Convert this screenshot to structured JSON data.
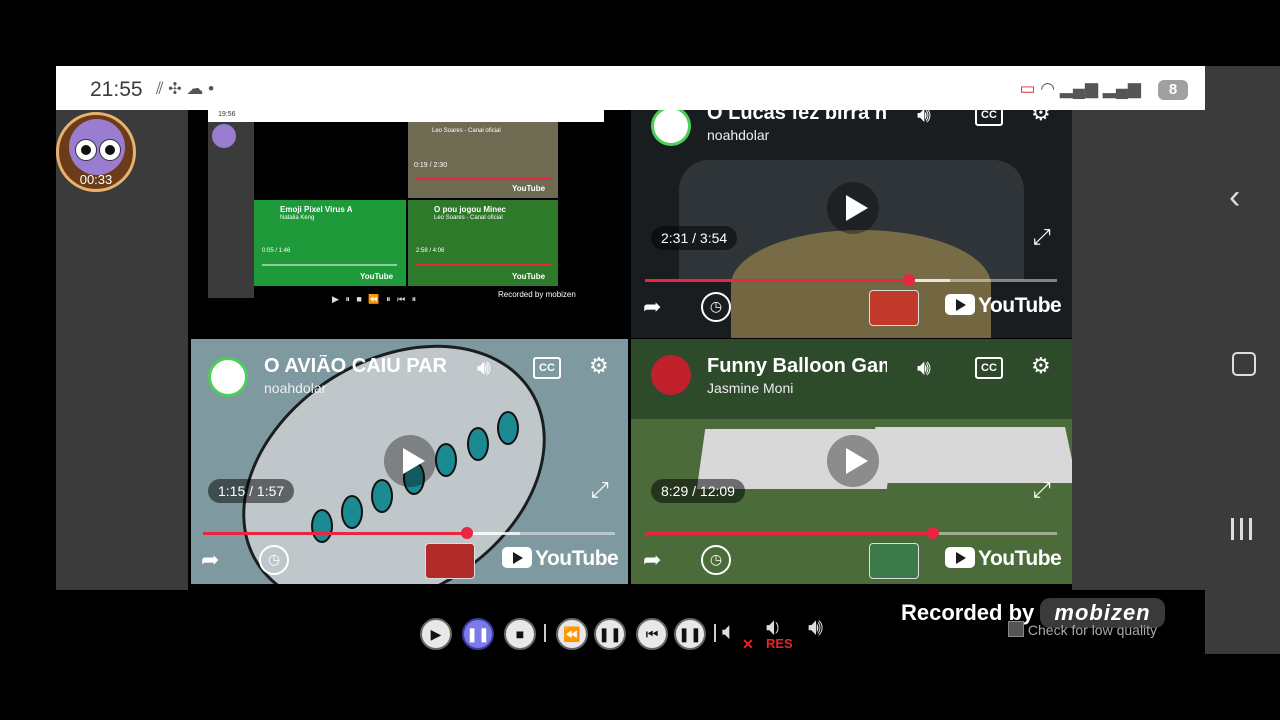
{
  "status": {
    "time": "21:55",
    "icons_left": "⫽ ✣ ☁ •",
    "battery": "8"
  },
  "avatar": {
    "time": "00:33"
  },
  "mini": {
    "time": "19:56",
    "v1_title": "Emoji Pixel Virus A",
    "v1_channel": "Natalia Keng",
    "v1_time": "0:05 / 1:46",
    "v2_title": "O pou jogou Minec",
    "v2_channel": "Leo Soares - Canal oficial",
    "v2_time": "2:58 / 4:06",
    "v3_channel": "Leo Soares - Canal oficial",
    "v3_time": "0:19 / 2:30",
    "yt_label": "YouTube",
    "recorded_label": "Recorded by mobizen"
  },
  "videos": [
    {
      "title": "O Lucas fez birra n",
      "channel": "noahdolar",
      "current": "2:31",
      "total": "3:54",
      "progress": 0.64,
      "buffered": 0.74,
      "yt_label": "YouTube"
    },
    {
      "title": "O AVIÃO CAIU PAR",
      "channel": "noahdolar",
      "current": "1:15",
      "total": "1:57",
      "progress": 0.64,
      "buffered": 0.77,
      "yt_label": "YouTube"
    },
    {
      "title": "Funny Balloon Gam",
      "channel": "Jasmine Moni",
      "current": "8:29",
      "total": "12:09",
      "progress": 0.7,
      "buffered": 0.7,
      "yt_label": "YouTube"
    }
  ],
  "cc": "CC",
  "recorder": {
    "recorded_label": "Recorded by",
    "brand": "mobizen",
    "check_low": "Check for low quality",
    "res_label": "RES"
  },
  "colors": {
    "accent_red": "#e8263f",
    "panel_gray": "#3b3b3b",
    "avatar_ring": "#4bcf5a"
  }
}
